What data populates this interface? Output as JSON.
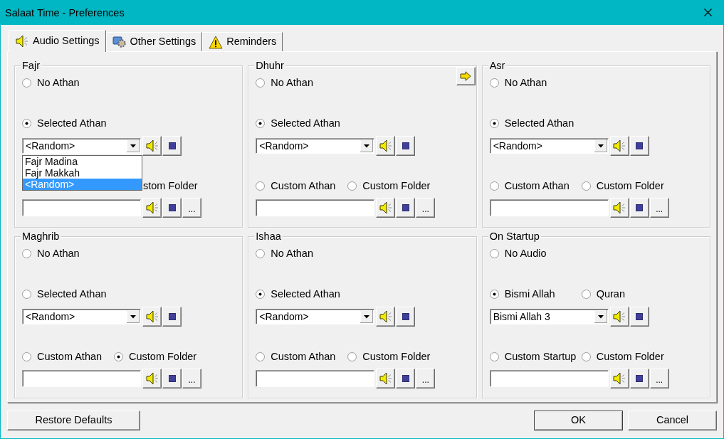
{
  "window": {
    "title": "Salaat Time - Preferences"
  },
  "tabs": [
    {
      "label": "Audio Settings",
      "selected": true
    },
    {
      "label": "Other Settings",
      "selected": false
    },
    {
      "label": "Reminders",
      "selected": false
    }
  ],
  "groups": [
    {
      "title": "Fajr",
      "options_top": [
        {
          "kind": "radio",
          "label": "No Athan",
          "checked": false
        }
      ],
      "options_middle": [
        {
          "kind": "radio",
          "label": "Selected Athan",
          "checked": true
        }
      ],
      "combo": {
        "value": "<Random>"
      },
      "dropdown_list": [
        {
          "label": "Fajr Madina",
          "selected": false
        },
        {
          "label": "Fajr Makkah",
          "selected": false
        },
        {
          "label": "<Random>",
          "selected": true
        }
      ],
      "options_bottom": [
        {
          "kind": "partial_label",
          "label": "stom Folder"
        }
      ],
      "browse_button": "..."
    },
    {
      "title": "Dhuhr",
      "arrow_button": true,
      "options_top": [
        {
          "kind": "radio",
          "label": "No Athan",
          "checked": false
        }
      ],
      "options_middle": [
        {
          "kind": "radio",
          "label": "Selected Athan",
          "checked": true
        }
      ],
      "combo": {
        "value": "<Random>"
      },
      "options_bottom": [
        {
          "kind": "radio",
          "label": "Custom Athan",
          "checked": false
        },
        {
          "kind": "radio",
          "label": "Custom Folder",
          "checked": false
        }
      ],
      "browse_button": "..."
    },
    {
      "title": "Asr",
      "options_top": [
        {
          "kind": "radio",
          "label": "No Athan",
          "checked": false
        }
      ],
      "options_middle": [
        {
          "kind": "radio",
          "label": "Selected Athan",
          "checked": true
        }
      ],
      "combo": {
        "value": "<Random>"
      },
      "options_bottom": [
        {
          "kind": "radio",
          "label": "Custom Athan",
          "checked": false
        },
        {
          "kind": "radio",
          "label": "Custom Folder",
          "checked": false
        }
      ],
      "browse_button": "..."
    },
    {
      "title": "Maghrib",
      "options_top": [
        {
          "kind": "radio",
          "label": "No Athan",
          "checked": false
        }
      ],
      "options_middle": [
        {
          "kind": "radio",
          "label": "Selected Athan",
          "checked": false
        }
      ],
      "combo": {
        "value": "<Random>"
      },
      "options_bottom": [
        {
          "kind": "radio",
          "label": "Custom Athan",
          "checked": false
        },
        {
          "kind": "radio",
          "label": "Custom Folder",
          "checked": true
        }
      ],
      "browse_button": "..."
    },
    {
      "title": "Ishaa",
      "options_top": [
        {
          "kind": "radio",
          "label": "No Athan",
          "checked": false
        }
      ],
      "options_middle": [
        {
          "kind": "radio",
          "label": "Selected Athan",
          "checked": true
        }
      ],
      "combo": {
        "value": "<Random>"
      },
      "options_bottom": [
        {
          "kind": "radio",
          "label": "Custom Athan",
          "checked": false
        },
        {
          "kind": "radio",
          "label": "Custom Folder",
          "checked": false
        }
      ],
      "browse_button": "..."
    },
    {
      "title": "On Startup",
      "options_top": [
        {
          "kind": "radio",
          "label": "No Audio",
          "checked": false
        }
      ],
      "options_middle": [
        {
          "kind": "radio",
          "label": "Bismi Allah",
          "checked": true
        },
        {
          "kind": "radio",
          "label": "Quran",
          "checked": false
        }
      ],
      "combo": {
        "value": "Bismi Allah 3"
      },
      "options_bottom": [
        {
          "kind": "radio",
          "label": "Custom Startup",
          "checked": false
        },
        {
          "kind": "radio",
          "label": "Custom Folder",
          "checked": false
        }
      ],
      "browse_button": "..."
    }
  ],
  "footer": {
    "left_buttons": [
      {
        "label": "Restore Defaults",
        "default": false
      }
    ],
    "right_buttons": [
      {
        "label": "OK",
        "default": true
      },
      {
        "label": "Cancel",
        "default": false
      }
    ]
  }
}
